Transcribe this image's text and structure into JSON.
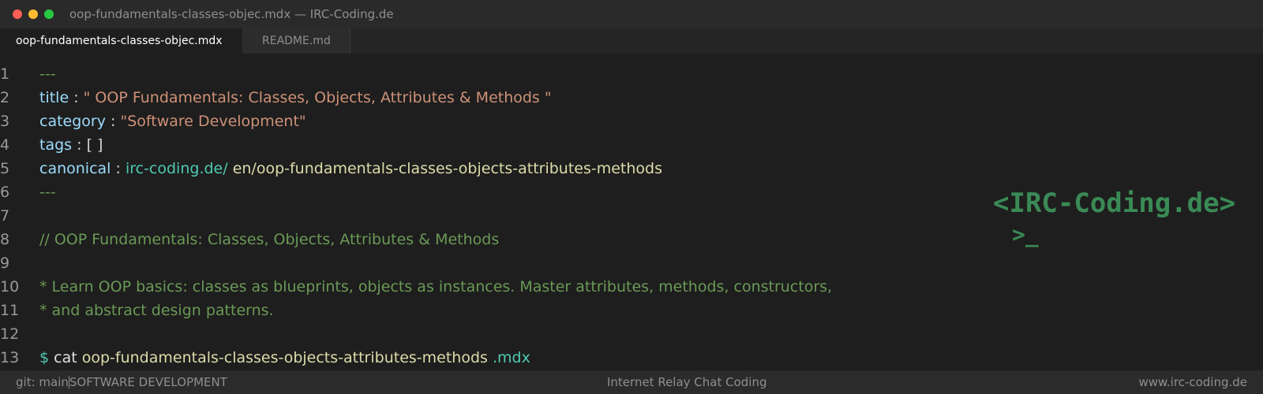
{
  "window": {
    "title": "oop-fundamentals-classes-objec.mdx — IRC-Coding.de"
  },
  "tabs": [
    {
      "label": "oop-fundamentals-classes-objec.mdx",
      "active": true
    },
    {
      "label": "README.md",
      "active": false
    }
  ],
  "editor": {
    "line_numbers": [
      "1",
      "2",
      "3",
      "4",
      "5",
      "6",
      "7",
      "8",
      "9",
      "10",
      "11",
      "12",
      "13"
    ],
    "frontmatter": {
      "delimiter": "---",
      "title_key": "title",
      "title_value": "\" OOP Fundamentals: Classes, Objects, Attributes & Methods \"",
      "category_key": "category",
      "category_value": "\"Software Development\"",
      "tags_key": "tags",
      "tags_value": "[ ]",
      "canonical_key": "canonical",
      "canonical_domain": "irc-coding.de/",
      "canonical_path": "en/oop-fundamentals-classes-objects-attributes-methods",
      "separator": ":"
    },
    "comment_line": "// OOP Fundamentals: Classes, Objects, Attributes & Methods",
    "desc_line_1": "* Learn OOP basics: classes as blueprints, objects as instances. Master attributes, methods, constructors,",
    "desc_line_2": "* and abstract design patterns.",
    "terminal": {
      "prompt": "$",
      "command": "cat",
      "filename": "oop-fundamentals-classes-objects-attributes-methods",
      "extension": ".mdx"
    }
  },
  "logo": {
    "text": "<IRC-Coding.de>",
    "prompt": ">_"
  },
  "statusbar": {
    "branch": "git: main",
    "category": "SOFTWARE DEVELOPMENT",
    "center": "Internet Relay Chat Coding",
    "right": "www.irc-coding.de"
  },
  "colors": {
    "background": "#1e1e1e",
    "comment": "#6a9955",
    "key": "#9cdcfe",
    "string": "#ce9178",
    "link": "#4ec9b0",
    "path": "#dcdcaa",
    "logo": "#3a8a55"
  }
}
